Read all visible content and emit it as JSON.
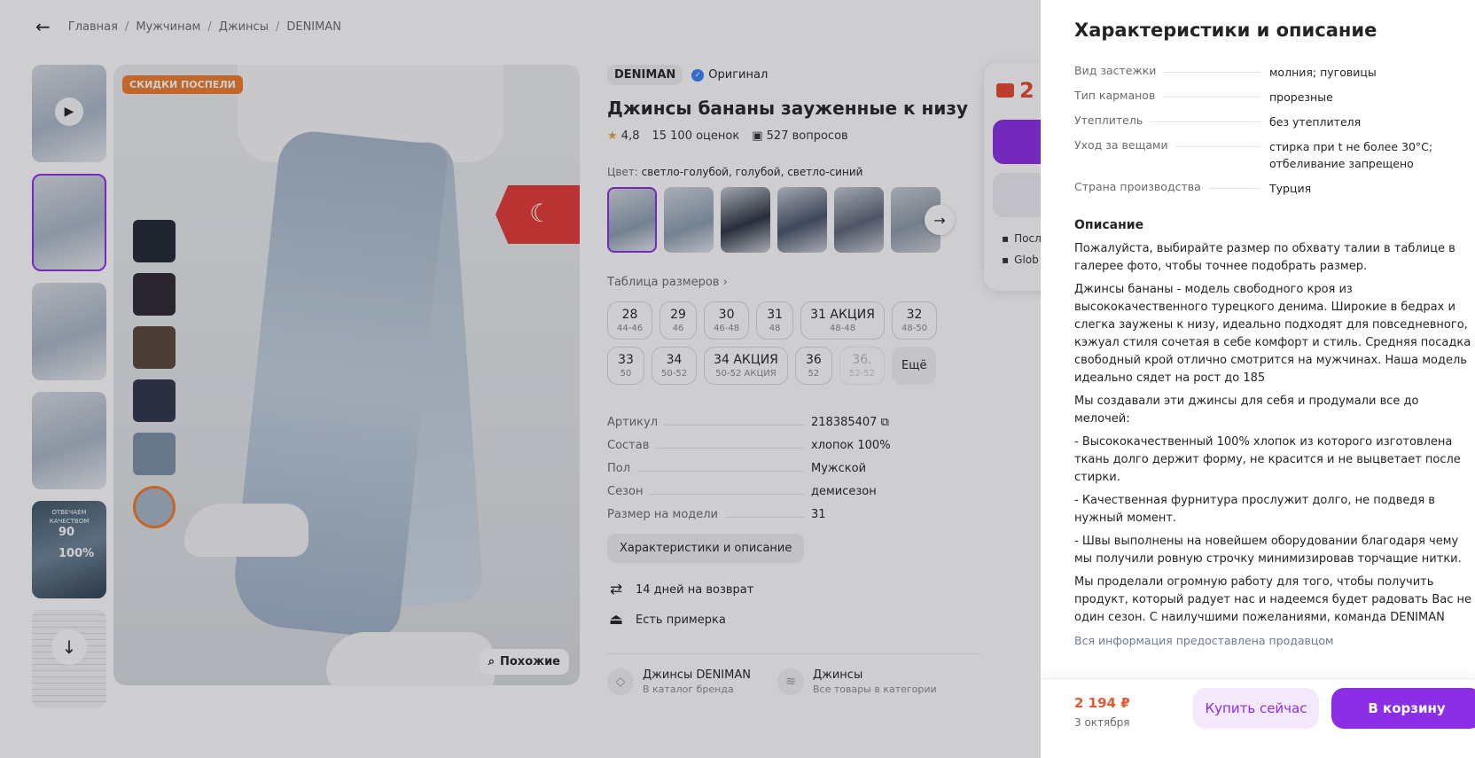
{
  "breadcrumbs": [
    "Главная",
    "Мужчинам",
    "Джинсы",
    "DENIMAN"
  ],
  "gallery": {
    "sale_badge": "СКИДКИ ПОСПЕЛИ",
    "similar_label": "Похожие",
    "thumb_promo": {
      "line1": "ОТВЕЧАЕМ КАЧЕСТВОМ",
      "line2": "90",
      "line3": "100%"
    }
  },
  "product": {
    "brand": "DENIMAN",
    "original_label": "Оригинал",
    "title": "Джинсы бананы зауженные к низу",
    "rating": "4,8",
    "reviews": "15 100 оценок",
    "questions": "527 вопросов",
    "color_label": "Цвет:",
    "color_value": "светло-голубой, голубой, светло-синий",
    "size_table_link": "Таблица размеров",
    "sizes": [
      {
        "n": "28",
        "s": "44-46"
      },
      {
        "n": "29",
        "s": "46"
      },
      {
        "n": "30",
        "s": "46-48"
      },
      {
        "n": "31",
        "s": "48"
      },
      {
        "n": "31 АКЦИЯ",
        "s": "48-48"
      },
      {
        "n": "32",
        "s": "48-50"
      },
      {
        "n": "33",
        "s": "50"
      },
      {
        "n": "34",
        "s": "50-52"
      },
      {
        "n": "34 АКЦИЯ",
        "s": "50-52 АКЦИЯ"
      },
      {
        "n": "36",
        "s": "52"
      },
      {
        "n": "36.",
        "s": "52-52",
        "disabled": true
      }
    ],
    "sizes_more": "Ещё",
    "specs": [
      {
        "k": "Артикул",
        "v": "218385407"
      },
      {
        "k": "Состав",
        "v": "хлопок 100%"
      },
      {
        "k": "Пол",
        "v": "Мужской"
      },
      {
        "k": "Сезон",
        "v": "демисезон"
      },
      {
        "k": "Размер на модели",
        "v": "31"
      }
    ],
    "desc_button": "Характеристики и описание",
    "return_label": "14 дней на возврат",
    "fitting_label": "Есть примерка",
    "brand_card": {
      "title": "Джинсы DENIMAN",
      "sub": "В каталог бренда"
    },
    "category_card": {
      "title": "Джинсы",
      "sub": "Все товары в категории"
    }
  },
  "pricebox": {
    "price_partial": "2",
    "line1": "Посл",
    "line2": "Glob"
  },
  "panel": {
    "title": "Характеристики и описание",
    "rows": [
      {
        "k": "Вид застежки",
        "v": "молния; пуговицы"
      },
      {
        "k": "Тип карманов",
        "v": "прорезные"
      },
      {
        "k": "Утеплитель",
        "v": "без утеплителя"
      },
      {
        "k": "Уход за вещами",
        "v": "стирка при t не более 30°C; отбеливание запрещено"
      },
      {
        "k": "Страна производства",
        "v": "Турция"
      }
    ],
    "desc_title": "Описание",
    "paragraphs": [
      [
        "Пожалуйста, выбирайте размер по обхвату талии в таблице в",
        "галерее фото, чтобы точнее подобрать размер."
      ],
      [
        "Джинсы бананы - модель свободного кроя из",
        "высококачественного турецкого денима. Широкие в бедрах и",
        "слегка заужены к низу, идеально подходят для повседневного,",
        "кэжуал стиля сочетая в себе комфорт и стиль. Средняя посадка",
        "свободный крой отлично смотрится на мужчинах. Наша модель",
        "идеально сядет на рост до 185"
      ],
      [
        "Мы создавали эти джинсы для себя и продумали все до",
        "мелочей:"
      ],
      [
        "- Высококачественный 100% хлопок из которого изготовлена",
        "ткань долго держит форму, не красится и не выцветает после",
        "стирки."
      ],
      [
        "- Качественная фурнитура прослужит долго, не подведя в",
        "нужный момент."
      ],
      [
        "- Швы выполнены на новейшем оборудовании благодаря чему",
        "мы получили ровную строчку минимизировав торчащие нитки."
      ],
      [
        "Мы проделали огромную работу для того, чтобы получить",
        "продукт, который радует нас и надеемся будет радовать Вас не",
        "один сезон. С наилучшими пожеланиями, команда DENIMAN"
      ]
    ],
    "note": "Вся информация предоставлена продавцом",
    "price": "2 194 ₽",
    "date": "3 октября",
    "buy_now": "Купить сейчас",
    "to_cart": "В корзину"
  }
}
